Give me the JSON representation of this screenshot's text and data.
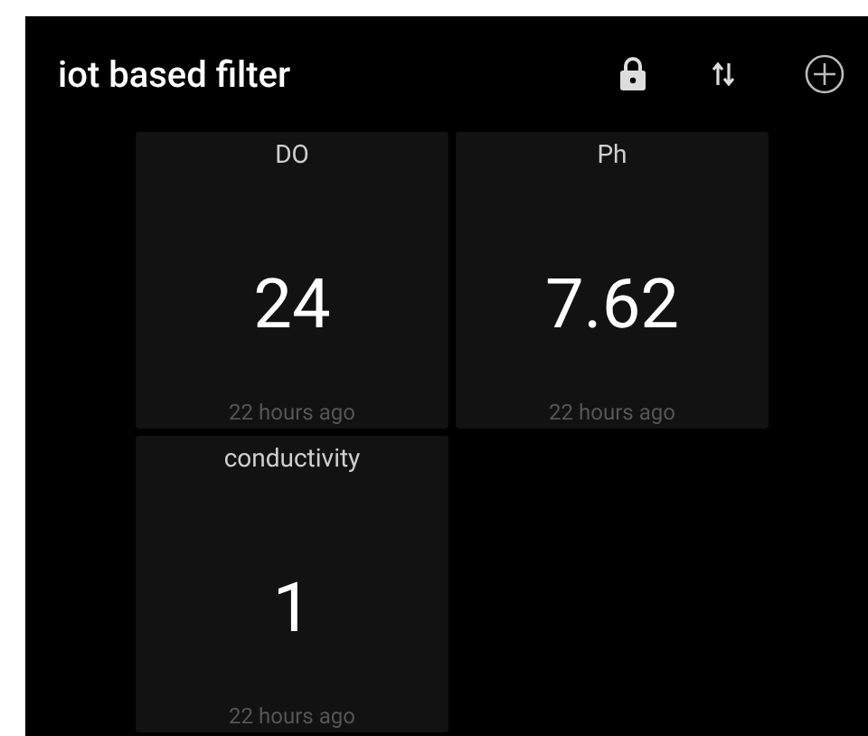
{
  "app_bar": {
    "title": "iot based filter"
  },
  "tiles": [
    {
      "label": "DO",
      "value": "24",
      "updated": "22 hours ago"
    },
    {
      "label": "Ph",
      "value": "7.62",
      "updated": "22 hours ago"
    },
    {
      "label": "conductivity",
      "value": "1",
      "updated": "22 hours ago"
    }
  ]
}
